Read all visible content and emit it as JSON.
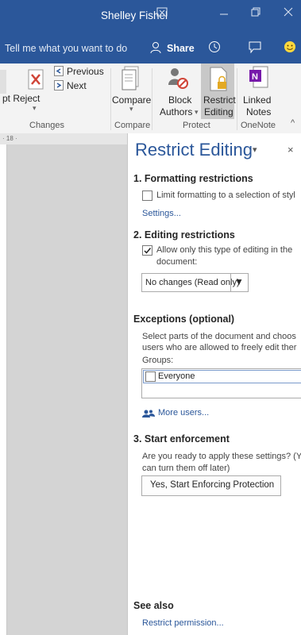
{
  "titlebar": {
    "user": "Shelley Fishel",
    "icons": [
      "ribbon-display-icon",
      "minimize-icon",
      "restore-icon",
      "close-icon"
    ]
  },
  "tellbar": {
    "tell_me": "Tell me what you want to do",
    "share": "Share",
    "icons": [
      "person-icon",
      "history-icon",
      "comment-icon",
      "smiley-icon"
    ]
  },
  "ribbon": {
    "changes": {
      "reject": "pt Reject",
      "previous": "Previous",
      "next": "Next",
      "label": "Changes"
    },
    "compare": {
      "button": "Compare",
      "label": "Compare"
    },
    "protect": {
      "block_line1": "Block",
      "block_line2": "Authors",
      "restrict_line1": "Restrict",
      "restrict_line2": "Editing",
      "label": "Protect"
    },
    "onenote": {
      "line1": "Linked",
      "line2": "Notes",
      "label": "OneNote"
    }
  },
  "ruler": {
    "mark": "· 18 ·"
  },
  "pane": {
    "title": "Restrict Editing",
    "section1": {
      "heading": "1. Formatting restrictions",
      "checkbox_label": "Limit formatting to a selection of styl",
      "settings_link": "Settings..."
    },
    "section2": {
      "heading": "2. Editing restrictions",
      "checkbox_line1": "Allow only this type of editing in the",
      "checkbox_line2": "document:",
      "dropdown_value": "No changes (Read only)"
    },
    "exceptions": {
      "heading": "Exceptions (optional)",
      "desc_line1": "Select parts of the document and choos",
      "desc_line2": "users who are allowed to freely edit ther",
      "groups_label": "Groups:",
      "group_everyone": "Everyone",
      "more_users": "More users..."
    },
    "section3": {
      "heading": "3. Start enforcement",
      "question_line1": "Are you ready to apply these settings? (Y",
      "question_line2": "can turn them off later)",
      "button": "Yes, Start Enforcing Protection"
    },
    "see_also": {
      "heading": "See also",
      "link": "Restrict permission..."
    }
  },
  "colors": {
    "accent": "#2b579a",
    "ribbon": "#f3f3f3",
    "pane": "#ffffff",
    "gutter": "#d4d4d4"
  }
}
